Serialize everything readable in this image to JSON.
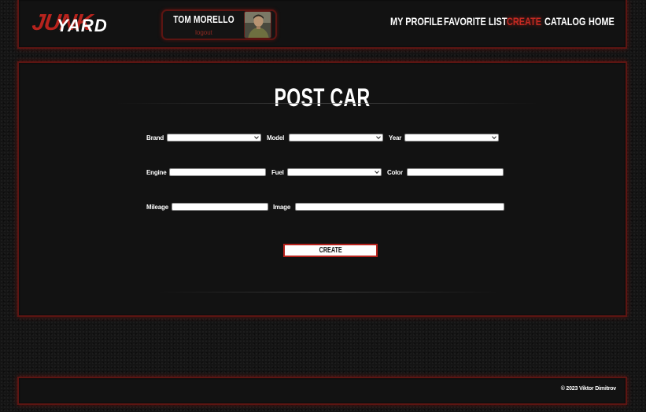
{
  "header": {
    "logo": {
      "part1": "JUNK",
      "part2": "YARD"
    },
    "user": {
      "name": "TOM MORELLO",
      "logout": "logout"
    },
    "nav": [
      {
        "label": "MY PROFILE",
        "active": false
      },
      {
        "label": "FAVORITE LIST",
        "active": false
      },
      {
        "label": "CREATE",
        "active": true
      },
      {
        "label": "CATALOG",
        "active": false
      },
      {
        "label": "HOME",
        "active": false
      }
    ]
  },
  "form": {
    "title": "POST CAR",
    "labels": {
      "brand": "Brand",
      "model": "Model",
      "year": "Year",
      "engine": "Engine",
      "fuel": "Fuel",
      "color": "Color",
      "mileage": "Mileage",
      "image": "Image"
    },
    "values": {
      "brand": "",
      "model": "",
      "year": "",
      "engine": "",
      "fuel": "",
      "color": "",
      "mileage": "",
      "image": ""
    },
    "submit_label": "CREATE"
  },
  "footer": {
    "copyright": "© 2023 Viktor Dimitrov"
  },
  "colors": {
    "accent": "#b7231d",
    "background": "#141414",
    "panel": "#121212"
  }
}
